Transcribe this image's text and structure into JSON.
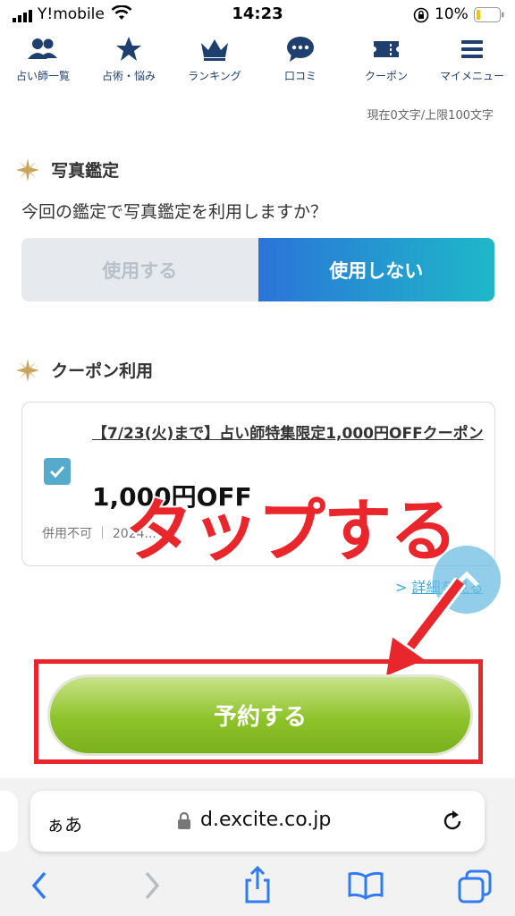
{
  "status_bar": {
    "carrier": "Y!mobile",
    "time": "14:23",
    "battery": "10%"
  },
  "nav": {
    "items": [
      {
        "label": "占い師一覧",
        "icon": "users-icon"
      },
      {
        "label": "占術・悩み",
        "icon": "star-icon"
      },
      {
        "label": "ランキング",
        "icon": "crown-icon"
      },
      {
        "label": "口コミ",
        "icon": "chat-bubble-icon"
      },
      {
        "label": "クーポン",
        "icon": "ticket-icon"
      },
      {
        "label": "マイメニュー",
        "icon": "menu-icon"
      }
    ]
  },
  "form": {
    "char_count": "現在0文字/上限100文字"
  },
  "photo_section": {
    "title": "写真鑑定",
    "question": "今回の鑑定で写真鑑定を利用しますか？",
    "option_use": "使用する",
    "option_no_use": "使用しない",
    "selected": "使用しない"
  },
  "coupon_section": {
    "title": "クーポン利用",
    "coupon_title": "【7/23(火)まで】占い師特集限定1,000円OFFクーポン",
    "discount": "1,000円OFF",
    "note": "併用不可 ｜ 2024...",
    "checked": true,
    "details_link": "詳細を見る"
  },
  "annotation": {
    "text": "タップする",
    "color": "#e8262b"
  },
  "reserve_button": {
    "label": "予約する"
  },
  "browser": {
    "text_size": "ぁあ",
    "url": "d.excite.co.jp"
  },
  "colors": {
    "accent": "#2b74d8",
    "teal": "#1eb8c8",
    "green": "#8ec32a",
    "nav_text": "#1f3f6e",
    "red": "#e8262b"
  }
}
